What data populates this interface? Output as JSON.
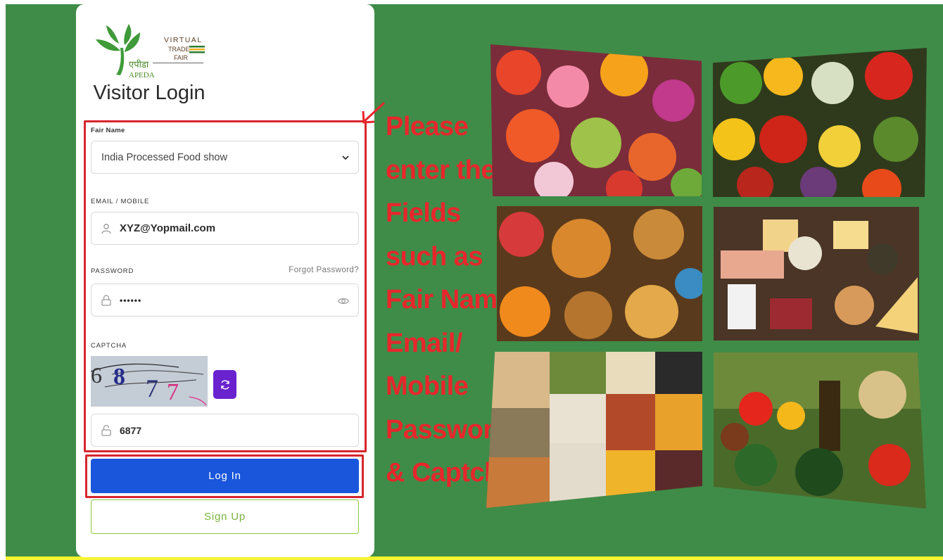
{
  "card": {
    "logo": {
      "line1": "VIRTUAL",
      "line2": "TRADE",
      "line3": "FAIR",
      "hindi": "एपीडा",
      "brand": "APEDA"
    },
    "title": "Visitor Login",
    "fair_name": {
      "label": "Fair Name",
      "selected": "India Processed Food show"
    },
    "email": {
      "label": "EMAIL / MOBILE",
      "value": "XYZ@Yopmail.com"
    },
    "password": {
      "label": "PASSWORD",
      "masked_value": "••••••",
      "forgot_label": "Forgot Password?"
    },
    "captcha": {
      "label": "CAPTCHA",
      "image_text": "6877",
      "input_value": "6877"
    },
    "login_label": "Log In",
    "signup_label": "Sign Up"
  },
  "annotation": {
    "lines": [
      "Please",
      "enter the",
      "Fields",
      "such as",
      "Fair Name",
      "Email/",
      "Mobile",
      "Password",
      "& Captcha"
    ],
    "color": "#e8262c"
  },
  "colors": {
    "background": "#3f8c48",
    "login_button": "#1a56db",
    "signup_border": "#8bc53f",
    "refresh_button": "#6a22cf",
    "highlight": "#d6262e"
  },
  "icons": {
    "email": "user-icon",
    "password": "lock-icon",
    "captcha_input": "lock-icon",
    "visibility": "eye-icon",
    "refresh": "refresh-icon",
    "select": "chevron-down-icon"
  },
  "collage": [
    "flowers",
    "fresh-vegetables",
    "snacks-and-sweets",
    "dairy-and-meat",
    "grains-and-pulses",
    "vegetables-and-oil"
  ]
}
